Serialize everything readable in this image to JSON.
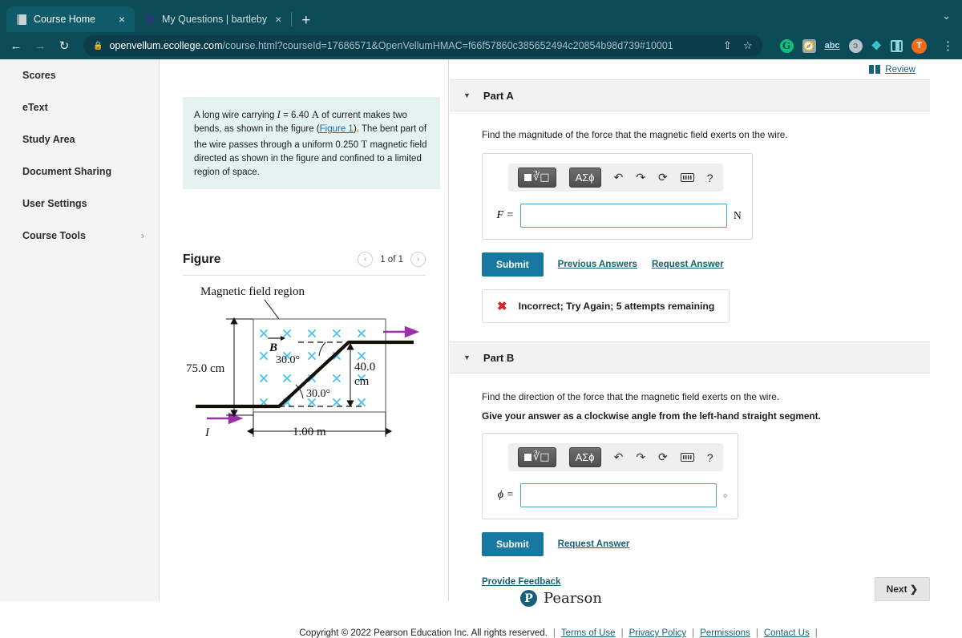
{
  "browser": {
    "tabs": [
      {
        "title": "Course Home",
        "favicon": "book-icon",
        "active": true,
        "close_label": "×"
      },
      {
        "title": "My Questions | bartleby",
        "favicon": "bartleby-b-icon",
        "active": false,
        "close_label": "×"
      }
    ],
    "new_tab_label": "+",
    "window_chevron": "⌄",
    "nav": {
      "back": "←",
      "forward": "→",
      "reload": "↻"
    },
    "omnibox": {
      "lock_icon": "lock-icon",
      "url_host": "openvellum.ecollege.com",
      "url_path": "/course.html?courseId=17686571&OpenVellumHMAC=f66f57860c385652494c20854b98d739#10001",
      "share_icon": "⇧",
      "bookmark_icon": "☆"
    },
    "extensions": [
      {
        "name": "grammarly-extension-icon",
        "label": "G"
      },
      {
        "name": "puzzle-gray-extension-icon",
        "label": "ᐳ"
      },
      {
        "name": "abc-spellcheck-icon",
        "label": "abc"
      },
      {
        "name": "c-extension-icon",
        "label": "ɔ"
      },
      {
        "name": "extensions-puzzle-icon",
        "label": "✦"
      },
      {
        "name": "reading-list-panel-icon",
        "label": ""
      },
      {
        "name": "profile-avatar",
        "label": "T"
      }
    ],
    "menu_icon": "⋮"
  },
  "sidebar": {
    "items": [
      {
        "label": "Scores",
        "has_chevron": false
      },
      {
        "label": "eText",
        "has_chevron": false
      },
      {
        "label": "Study Area",
        "has_chevron": false
      },
      {
        "label": "Document Sharing",
        "has_chevron": false
      },
      {
        "label": "User Settings",
        "has_chevron": false
      },
      {
        "label": "Course Tools",
        "has_chevron": true,
        "chevron": "›"
      }
    ]
  },
  "problem": {
    "text_1": "A long wire carrying ",
    "var_I": "I",
    "text_2": " = 6.40 ",
    "unit_A": "A",
    "text_3": " of current makes two bends, as shown in the figure (",
    "figure_link": "Figure 1",
    "text_4": "). The bent part of the wire passes through a uniform 0.250 ",
    "unit_T": "T",
    "text_5": " magnetic field directed as shown in the figure and confined to a limited region of space."
  },
  "figure": {
    "title": "Figure",
    "pager": "1 of 1",
    "prev_icon": "‹",
    "next_icon": "›",
    "caption": "Magnetic field region",
    "labels": {
      "field_vector": "B",
      "angle_top": "30.0°",
      "angle_bottom": "30.0°",
      "height_left": "75.0 cm",
      "height_right_1": "40.0",
      "height_right_2": "cm",
      "width": "1.00 m",
      "current": "I"
    },
    "field_symbol": "✕",
    "field_rows": 4,
    "field_cols": 5
  },
  "review": {
    "label": "Review",
    "icon": "book-icon"
  },
  "parts": [
    {
      "id": "part-a",
      "title": "Part A",
      "caret": "▼",
      "question": "Find the magnitude of the force that the magnetic field exerts on the wire.",
      "emphasis": "",
      "variable": "F =",
      "value": "",
      "unit": "N",
      "submit_label": "Submit",
      "links": [
        "Previous Answers",
        "Request Answer"
      ],
      "feedback": {
        "icon": "✖",
        "text": "Incorrect; Try Again; 5 attempts remaining"
      }
    },
    {
      "id": "part-b",
      "title": "Part B",
      "caret": "▼",
      "question": "Find the direction of the force that the magnetic field exerts on the wire.",
      "emphasis": "Give your answer as a clockwise angle from the left-hand straight segment.",
      "variable": "ϕ =",
      "value": "",
      "unit": "○",
      "submit_label": "Submit",
      "links": [
        "Request Answer"
      ],
      "feedback": null
    }
  ],
  "mathbar": {
    "template_btn": "template-icon",
    "greek_btn": "ΑΣϕ",
    "undo_icon": "↶",
    "redo_icon": "↷",
    "reset_icon": "⟳",
    "keyboard_icon": "keyboard-icon",
    "help_icon": "?"
  },
  "footer": {
    "provide_feedback": "Provide Feedback",
    "next_label": "Next ❯",
    "brand": "Pearson",
    "brand_mark": "P",
    "copyright": "Copyright © 2022 Pearson Education Inc. All rights reserved.",
    "links": [
      "Terms of Use",
      "Privacy Policy",
      "Permissions",
      "Contact Us"
    ]
  },
  "colors": {
    "browser_chrome": "#0b4a57",
    "accent_link": "#17607a",
    "submit_button": "#1778a0",
    "prompt_bg": "#e4f2f2",
    "error_red": "#d8232a",
    "field_cross": "#4ec3f0",
    "arrow_purple": "#9b31a8"
  }
}
